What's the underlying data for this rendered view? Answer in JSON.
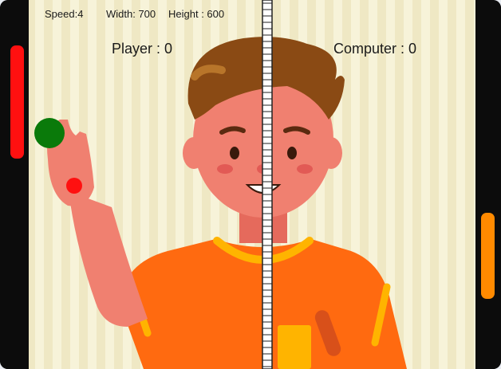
{
  "hud": {
    "speed": "Speed:4",
    "width": "Width: 700",
    "height": "Height : 600"
  },
  "scoreboard": {
    "player": "Player : 0",
    "computer": "Computer : 0"
  },
  "colors": {
    "court_stripe_light": "#f7f3d9",
    "court_stripe_dark": "#efe8c4",
    "side_wall": "#0c0c0c",
    "player_paddle": "#ff1010",
    "computer_paddle": "#ff8a00",
    "ball": "#0a7a0a",
    "marker": "#ff1010",
    "skin": "#f08070",
    "hair": "#8a4a14",
    "shirt": "#ff6a10",
    "shirt_trim": "#ffb400"
  },
  "icons": [
    "player-paddle-icon",
    "computer-paddle-icon",
    "ball-icon",
    "center-net-icon",
    "boy-illustration-icon"
  ]
}
